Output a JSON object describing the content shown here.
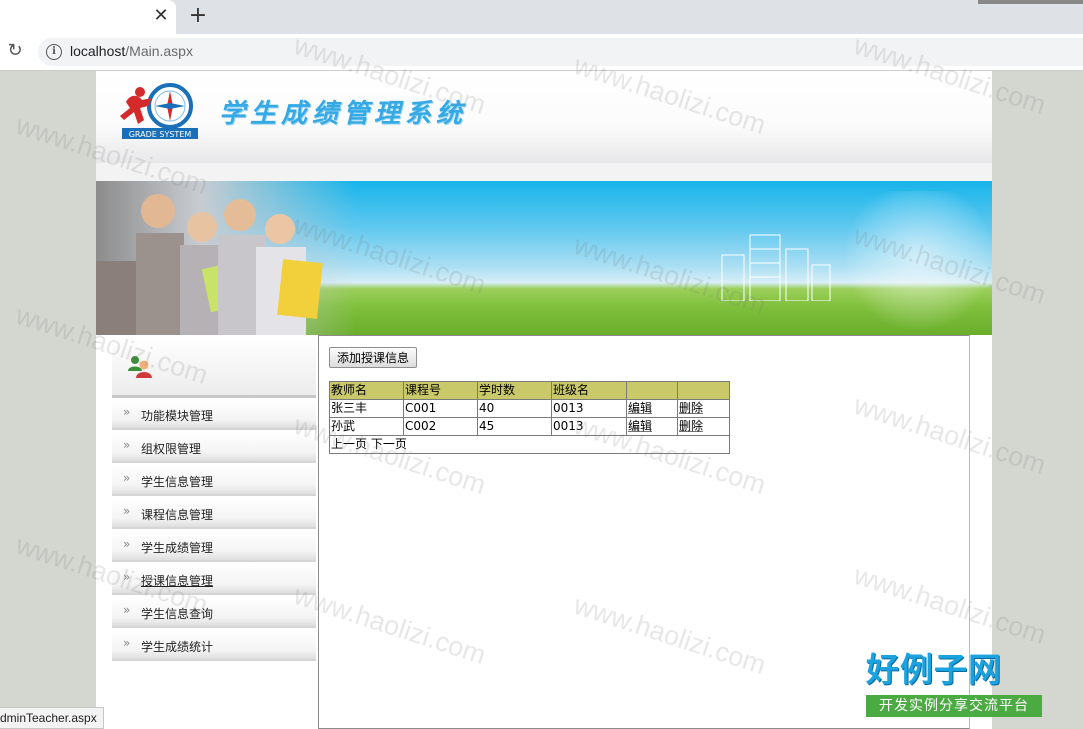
{
  "browser": {
    "tab_close": "✕",
    "new_tab": "+",
    "reload": "↻",
    "info": "i",
    "url_host": "localhost",
    "url_path": "/Main.aspx"
  },
  "header": {
    "title": "学生成绩管理系统",
    "logo_text": "GRADE SYSTEM"
  },
  "sidebar": {
    "items": [
      {
        "label": "功能模块管理"
      },
      {
        "label": "组权限管理"
      },
      {
        "label": "学生信息管理"
      },
      {
        "label": "课程信息管理"
      },
      {
        "label": "学生成绩管理"
      },
      {
        "label": "授课信息管理"
      },
      {
        "label": "学生信息查询"
      },
      {
        "label": "学生成绩统计"
      }
    ],
    "arrow": "»"
  },
  "main": {
    "add_button": "添加授课信息",
    "columns": [
      "教师名",
      "课程号",
      "学时数",
      "班级名",
      "",
      ""
    ],
    "rows": [
      {
        "teacher": "张三丰",
        "course": "C001",
        "hours": "40",
        "class": "0013",
        "edit": "编辑",
        "delete": "删除"
      },
      {
        "teacher": "孙武",
        "course": "C002",
        "hours": "45",
        "class": "0013",
        "edit": "编辑",
        "delete": "删除"
      }
    ],
    "prev": "上一页",
    "next": "下一页"
  },
  "statusbar": {
    "text": "dminTeacher.aspx"
  },
  "watermark": {
    "text": "www.haolizi.com"
  },
  "brand": {
    "name": "好例子网",
    "slogan": "开发实例分享交流平台"
  },
  "colors": {
    "title_blue": "#35a9e4",
    "table_header": "#c9c96a",
    "brand_blue": "#1aa3de",
    "brand_green": "#4caa43"
  }
}
